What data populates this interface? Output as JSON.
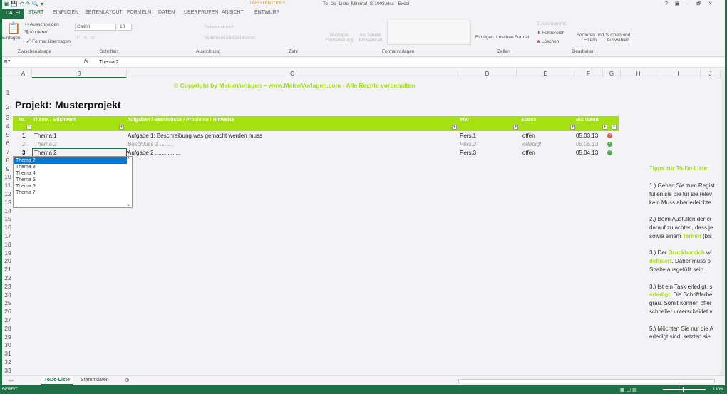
{
  "window": {
    "title": "To_Do_Liste_Minimal_S-1003.xlsx - Excel",
    "context_tab": "TABELLENTOOLS",
    "controls": [
      "?",
      "▣",
      "–",
      "🗗",
      "✕"
    ]
  },
  "tabs": [
    {
      "label": "DATEI"
    },
    {
      "label": "START"
    },
    {
      "label": "EINFÜGEN"
    },
    {
      "label": "SEITENLAYOUT"
    },
    {
      "label": "FORMELN"
    },
    {
      "label": "DATEN"
    },
    {
      "label": "ÜBERPRÜFEN"
    },
    {
      "label": "ANSICHT"
    },
    {
      "label": "ENTWURF"
    }
  ],
  "ribbon": {
    "clipboard": {
      "paste": "Einfügen",
      "cut": "Ausschneiden",
      "copy": "Kopieren",
      "painter": "Format übertragen",
      "group": "Zwischenablage"
    },
    "font": {
      "name": "Calibri",
      "size": "10",
      "bold": "F",
      "italic": "K",
      "underline": "U",
      "group": "Schriftart"
    },
    "align": {
      "wrap": "Zeilenumbruch",
      "merge": "Verbinden und zentrieren",
      "group": "Ausrichtung"
    },
    "number": {
      "group": "Zahl"
    },
    "styles": {
      "cond": "Bedingte Formatierung",
      "table": "Als Tabelle formatieren",
      "group": "Formatvorlagen"
    },
    "cells": {
      "insert": "Einfügen",
      "delete": "Löschen",
      "format": "Format",
      "group": "Zellen"
    },
    "edit": {
      "autosum": "AutoSumme",
      "fill": "Füllbereich",
      "clear": "Löschen",
      "sort": "Sortieren und Filtern",
      "find": "Suchen und Auswählen",
      "group": "Bearbeiten"
    }
  },
  "formula_bar": {
    "name_box": "B7",
    "fx": "fx",
    "value": "Thema 2"
  },
  "columns": [
    "A",
    "B",
    "C",
    "D",
    "E",
    "F",
    "G",
    "H",
    "I",
    "J"
  ],
  "sheet": {
    "copyright": "© Copyright by MeineVorlagen – www.MeineVorlagen.com - Alle Rechte vorbehalten",
    "project_title": "Projekt: Musterprojekt",
    "headers": [
      "Nr.",
      "Thema / Stichwort",
      "Aufgaben / Beschlüsse / Probleme / Hinweise",
      "Wer",
      "Status",
      "Bis Wann"
    ],
    "rows": [
      {
        "nr": "1",
        "thema": "Thema 1",
        "aufgabe": "Aufgabe 1:  Beschreibung  was gemacht werden muss",
        "wer": "Pers.1",
        "status": "offen",
        "bis": "05.03.13",
        "icon": "red-x-icon",
        "done": false
      },
      {
        "nr": "2",
        "thema": "Thema 2",
        "aufgabe": "Beschluss 1 .........",
        "wer": "Pers.2",
        "status": "erledigt",
        "bis": "05.05.13",
        "icon": "green-check-icon",
        "done": true
      },
      {
        "nr": "3",
        "thema": "Thema 2",
        "aufgabe": "Aufgabe 2 ................",
        "wer": "Pers.3",
        "status": "offen",
        "bis": "05.04.13",
        "icon": "green-check-icon",
        "done": false
      }
    ],
    "dropdown": [
      "Thema 2",
      "Thema 3",
      "Thema 4",
      "Thema 5",
      "Thema 6",
      "Thema 7"
    ],
    "tips": {
      "title": "Tipps zur To-Do Liste:",
      "lines": [
        [
          "1.) Gehen Sie zum Regist"
        ],
        [
          "füllen sie die für sie relev"
        ],
        [
          "kein Muss aber erleichte"
        ],
        [
          ""
        ],
        [
          "2.) Beim Ausfüllen der ei"
        ],
        [
          "darauf zu achten, dass je"
        ],
        [
          "sowie einem ",
          "Termin",
          " (bis"
        ],
        [
          ""
        ],
        [
          "3.) Der ",
          "Druckbereich",
          " wi"
        ],
        [
          "",
          "definiert",
          ". Daher muss p"
        ],
        [
          "Spalte ausgefüllt sein."
        ],
        [
          ""
        ],
        [
          "3.) Ist ein Task erledigt, s"
        ],
        [
          "",
          "erledigt",
          ". Die Schriftfarbe"
        ],
        [
          "grau. Somit können offer"
        ],
        [
          "schneller unterscheidet v"
        ],
        [
          ""
        ],
        [
          "5.) Möchten Sie nur die A"
        ],
        [
          "erledigt sind, setzten sie"
        ]
      ]
    }
  },
  "sheet_tabs": [
    {
      "label": "ToDo-Liste",
      "active": true
    },
    {
      "label": "Stammdaten",
      "active": false
    }
  ],
  "status": {
    "text": "BEREIT",
    "zoom": "130%"
  },
  "colors": {
    "accent": "#a5e00f",
    "excel_green": "#1e7145",
    "selection": "#0078d7"
  }
}
